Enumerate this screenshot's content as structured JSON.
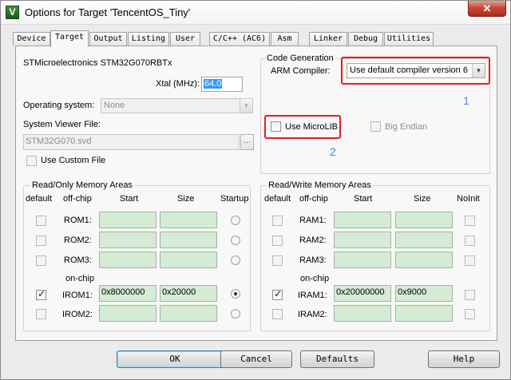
{
  "window": {
    "title": "Options for Target 'TencentOS_Tiny'",
    "close_label": "✕",
    "app_icon": "keil-uvision-icon"
  },
  "tabs": [
    "Device",
    "Target",
    "Output",
    "Listing",
    "User",
    "C/C++ (AC6)",
    "Asm",
    "Linker",
    "Debug",
    "Utilities"
  ],
  "active_tab": "Target",
  "target": {
    "device_name": "STMicroelectronics STM32G070RBTx",
    "xtal_label": "Xtal (MHz):",
    "xtal_value": "64.0",
    "os_label": "Operating system:",
    "os_value": "None",
    "svd_label": "System Viewer File:",
    "svd_value": "STM32G070.svd",
    "svd_browse": "...",
    "custom_file_label": "Use Custom File"
  },
  "codegen": {
    "group_title": "Code Generation",
    "compiler_label": "ARM Compiler:",
    "compiler_value": "Use default compiler version 6",
    "microlib_label": "Use MicroLIB",
    "big_endian_label": "Big Endian"
  },
  "annotations": {
    "one": "1",
    "two": "2"
  },
  "ro_memory": {
    "title": "Read/Only Memory Areas",
    "headers": {
      "default": "default",
      "offchip": "off-chip",
      "start": "Start",
      "size": "Size",
      "last": "Startup"
    },
    "onchip_label": "on-chip",
    "rows": [
      {
        "label": "ROM1:",
        "start": "",
        "size": "",
        "checked": false,
        "radio": false
      },
      {
        "label": "ROM2:",
        "start": "",
        "size": "",
        "checked": false,
        "radio": false
      },
      {
        "label": "ROM3:",
        "start": "",
        "size": "",
        "checked": false,
        "radio": false
      },
      {
        "label": "IROM1:",
        "start": "0x8000000",
        "size": "0x20000",
        "checked": true,
        "radio": true
      },
      {
        "label": "IROM2:",
        "start": "",
        "size": "",
        "checked": false,
        "radio": false
      }
    ]
  },
  "rw_memory": {
    "title": "Read/Write Memory Areas",
    "headers": {
      "default": "default",
      "offchip": "off-chip",
      "start": "Start",
      "size": "Size",
      "last": "NoInit"
    },
    "onchip_label": "on-chip",
    "rows": [
      {
        "label": "RAM1:",
        "start": "",
        "size": "",
        "checked": false
      },
      {
        "label": "RAM2:",
        "start": "",
        "size": "",
        "checked": false
      },
      {
        "label": "RAM3:",
        "start": "",
        "size": "",
        "checked": false
      },
      {
        "label": "IRAM1:",
        "start": "0x20000000",
        "size": "0x9000",
        "checked": true
      },
      {
        "label": "IRAM2:",
        "start": "",
        "size": "",
        "checked": false
      }
    ]
  },
  "buttons": {
    "ok": "OK",
    "cancel": "Cancel",
    "defaults": "Defaults",
    "help": "Help"
  },
  "colors": {
    "highlight_box": "#e41e1e",
    "annotation": "#3f88d6",
    "memory_field": "#d4ecd4",
    "selection": "#3399ff"
  }
}
